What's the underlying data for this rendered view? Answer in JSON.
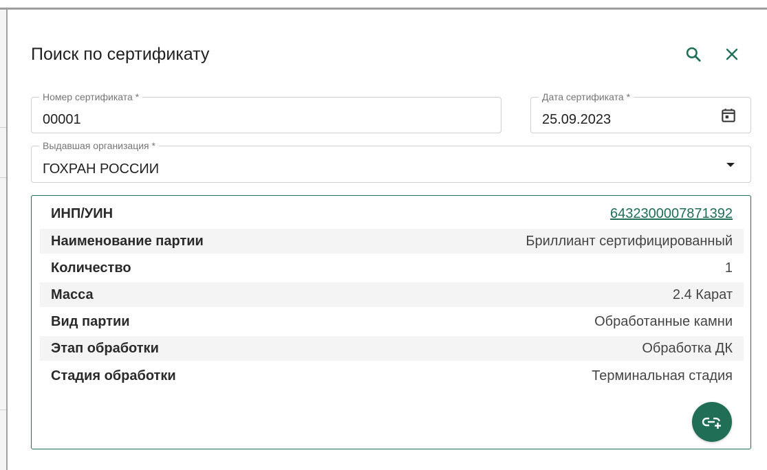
{
  "dialog": {
    "title": "Поиск по сертификату",
    "icons": {
      "search": "search-icon",
      "close": "close-icon"
    }
  },
  "form": {
    "certificate_number": {
      "label": "Номер сертификата *",
      "value": "00001"
    },
    "certificate_date": {
      "label": "Дата сертификата *",
      "value": "25.09.2023",
      "icon": "calendar-icon"
    },
    "issuing_org": {
      "label": "Выдавшая организация *",
      "value": "ГОХРАН РОССИИ",
      "icon": "chevron-down-icon"
    }
  },
  "result": {
    "rows": [
      {
        "label": "ИНП/УИН",
        "value": "6432300007871392",
        "is_link": true
      },
      {
        "label": "Наименование партии",
        "value": "Бриллиант сертифицированный"
      },
      {
        "label": "Количество",
        "value": "1"
      },
      {
        "label": "Масса",
        "value": "2.4 Карат"
      },
      {
        "label": "Вид партии",
        "value": "Обработанные камни"
      },
      {
        "label": "Этап обработки",
        "value": "Обработка ДК"
      },
      {
        "label": "Стадия обработки",
        "value": "Терминальная стадия"
      }
    ],
    "action_icon": "link-add-icon"
  },
  "colors": {
    "accent": "#1f6e55",
    "row_shade": "#f4f4f4",
    "border": "#cfcfcf"
  }
}
